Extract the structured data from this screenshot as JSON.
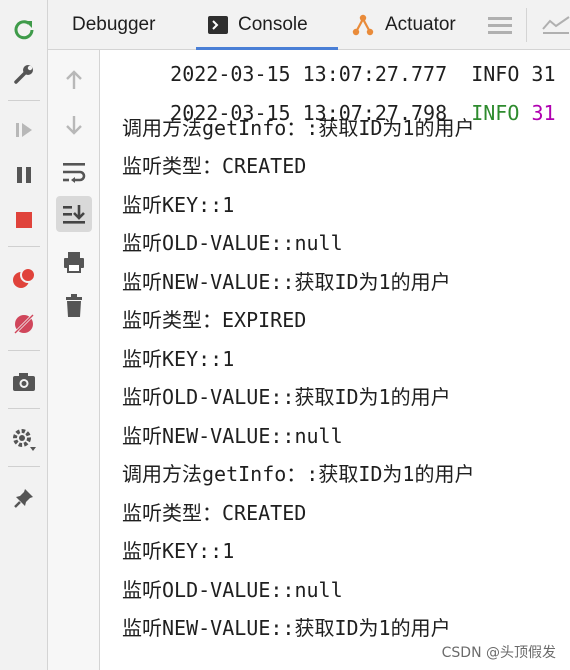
{
  "tabs": [
    {
      "label": "Debugger",
      "icon": "none"
    },
    {
      "label": "Console",
      "icon": "console-icon",
      "active": true
    },
    {
      "label": "Actuator",
      "icon": "actuator-icon"
    }
  ],
  "console": {
    "lines": [
      "2022-03-15 13:07:27.777  INFO 31",
      "2022-03-15 13:07:27.798",
      "调用方法getInfo：:获取ID为1的用户",
      "监听类型：CREATED",
      "监听KEY::1",
      "监听OLD-VALUE::null",
      "监听NEW-VALUE::获取ID为1的用户",
      "监听类型：EXPIRED",
      "监听KEY::1",
      "监听OLD-VALUE::获取ID为1的用户",
      "监听NEW-VALUE::null",
      "调用方法getInfo：:获取ID为1的用户",
      "监听类型：CREATED",
      "监听KEY::1",
      "监听OLD-VALUE::null",
      "监听NEW-VALUE::获取ID为1的用户"
    ],
    "log_level": "INFO",
    "pid_fragment": "31"
  },
  "watermark": "CSDN @头顶假发",
  "colors": {
    "rerun": "#3f9b4a",
    "stop": "#e0433b",
    "breakpoints": "#e0433b",
    "mute": "#d0465b",
    "info": "#2e8b2e",
    "pid": "#b000b0",
    "tab_underline": "#4a7fd6"
  }
}
